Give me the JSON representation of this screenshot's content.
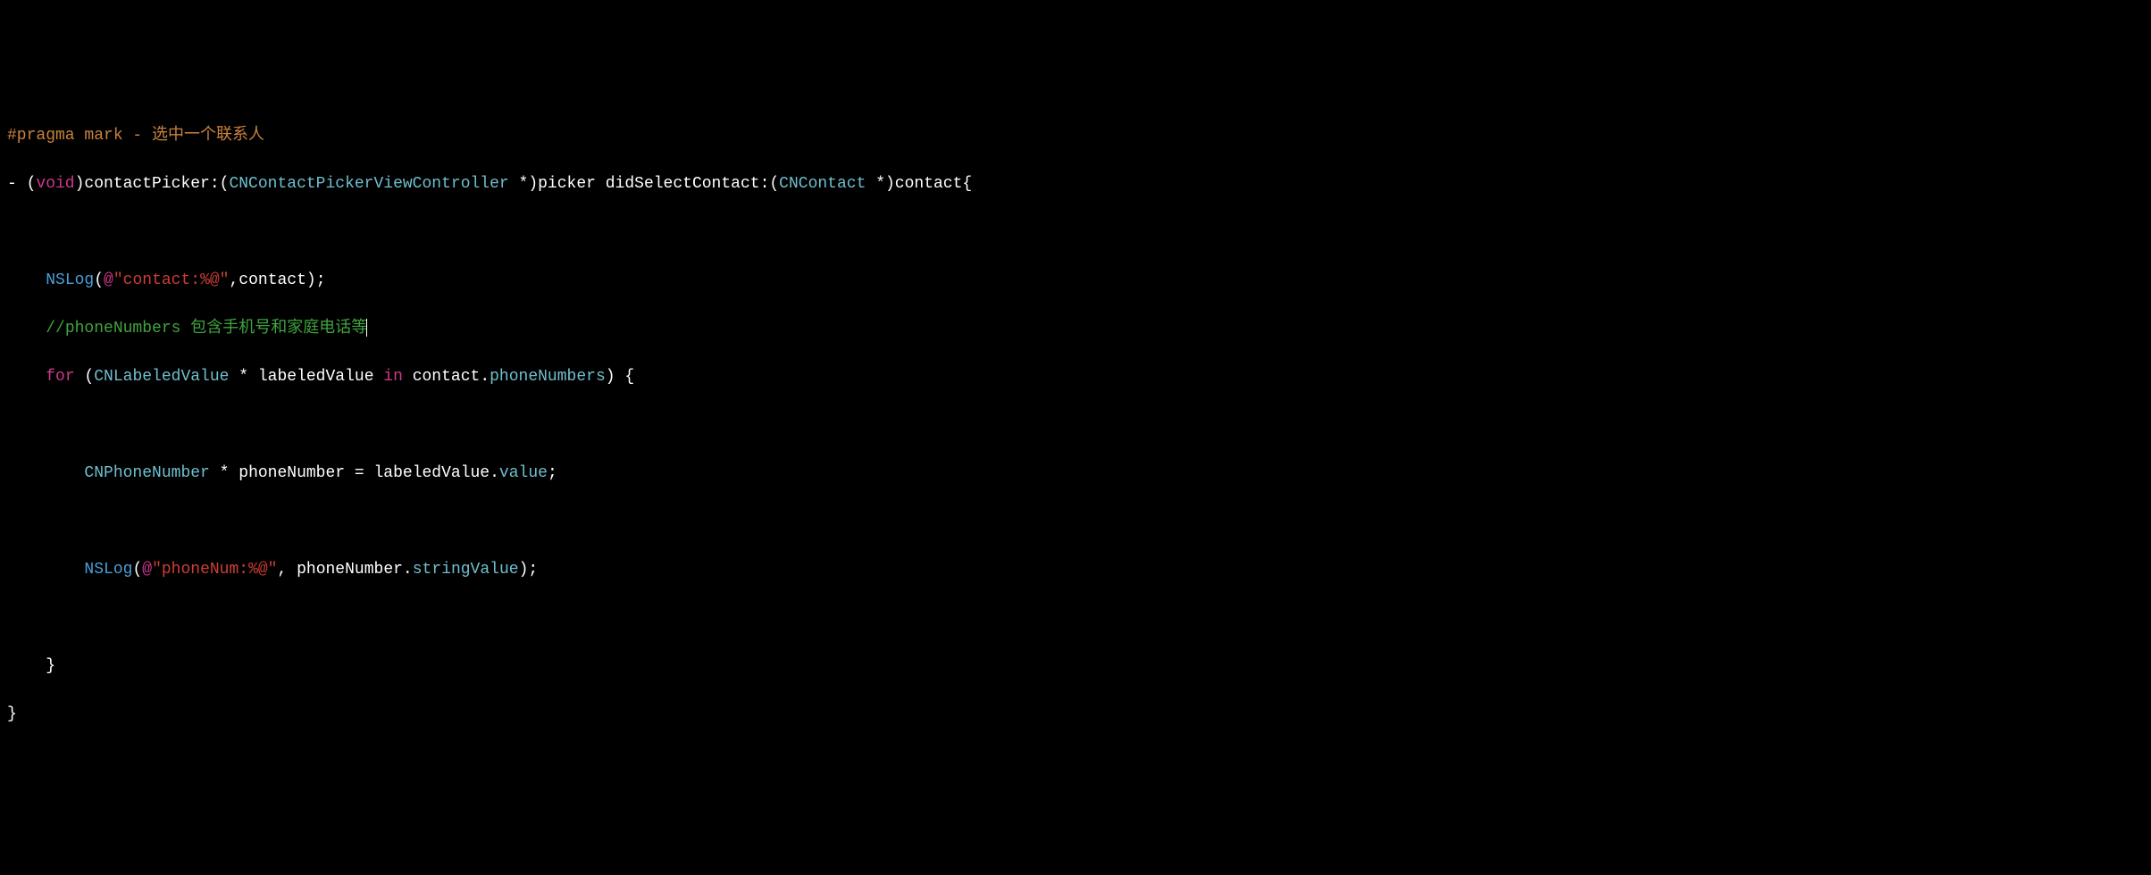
{
  "code": {
    "line1": {
      "pragma": "#pragma",
      "mark": " mark - 选中一个联系人"
    },
    "line2": {
      "prefix": "- (",
      "void": "void",
      "sig1": ")contactPicker:(",
      "type1": "CNContactPickerViewController",
      "sig2": " *)picker didSelectContact:(",
      "type2": "CNContact",
      "sig3": " *)contact{"
    },
    "line3": "",
    "line4": {
      "indent": "    ",
      "nslog": "NSLog",
      "open": "(",
      "at": "@",
      "str": "\"contact:%@\"",
      "rest": ",contact);"
    },
    "line5": {
      "indent": "    ",
      "comment": "//phoneNumbers 包含手机号和家庭电话等"
    },
    "line6": {
      "indent": "    ",
      "for": "for",
      "open": " (",
      "type": "CNLabeledValue",
      "mid": " * labeledValue ",
      "in": "in",
      "sp": " contact.",
      "prop": "phoneNumbers",
      "close": ") {"
    },
    "line7": "",
    "line8": {
      "indent": "        ",
      "type": "CNPhoneNumber",
      "mid": " * phoneNumber = labeledValue.",
      "prop": "value",
      "end": ";"
    },
    "line9": "",
    "line10": {
      "indent": "        ",
      "nslog": "NSLog",
      "open": "(",
      "at": "@",
      "str": "\"phoneNum:%@\"",
      "mid": ", phoneNumber.",
      "prop": "stringValue",
      "end": ");"
    },
    "line11": "",
    "line12": {
      "indent": "    ",
      "brace": "}"
    },
    "line13": {
      "brace": "}"
    }
  }
}
